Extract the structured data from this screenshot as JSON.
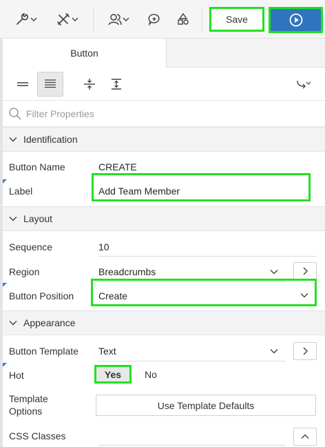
{
  "toolbar": {
    "save_label": "Save",
    "icons": [
      "wrench-icon",
      "tools-icon",
      "shared-components-icon",
      "comment-icon",
      "shapes-icon",
      "run-icon"
    ]
  },
  "tabs": [
    {
      "label": "Button"
    }
  ],
  "filter": {
    "placeholder": "Filter Properties"
  },
  "sections": {
    "identification": "Identification",
    "layout": "Layout",
    "appearance": "Appearance"
  },
  "properties": {
    "button_name": {
      "label": "Button Name",
      "value": "CREATE"
    },
    "label": {
      "label": "Label",
      "value": "Add Team Member"
    },
    "sequence": {
      "label": "Sequence",
      "value": "10"
    },
    "region": {
      "label": "Region",
      "value": "Breadcrumbs"
    },
    "button_position": {
      "label": "Button Position",
      "value": "Create"
    },
    "button_template": {
      "label": "Button Template",
      "value": "Text"
    },
    "hot": {
      "label": "Hot",
      "yes": "Yes",
      "no": "No",
      "selected": "Yes"
    },
    "template_options": {
      "label_line1": "Template",
      "label_line2": "Options",
      "button": "Use Template Defaults"
    },
    "css_classes": {
      "label": "CSS Classes",
      "value": ""
    }
  },
  "colors": {
    "highlight": "#22e022",
    "run_button": "#2f74be",
    "required_marker": "#3a7fc3"
  }
}
